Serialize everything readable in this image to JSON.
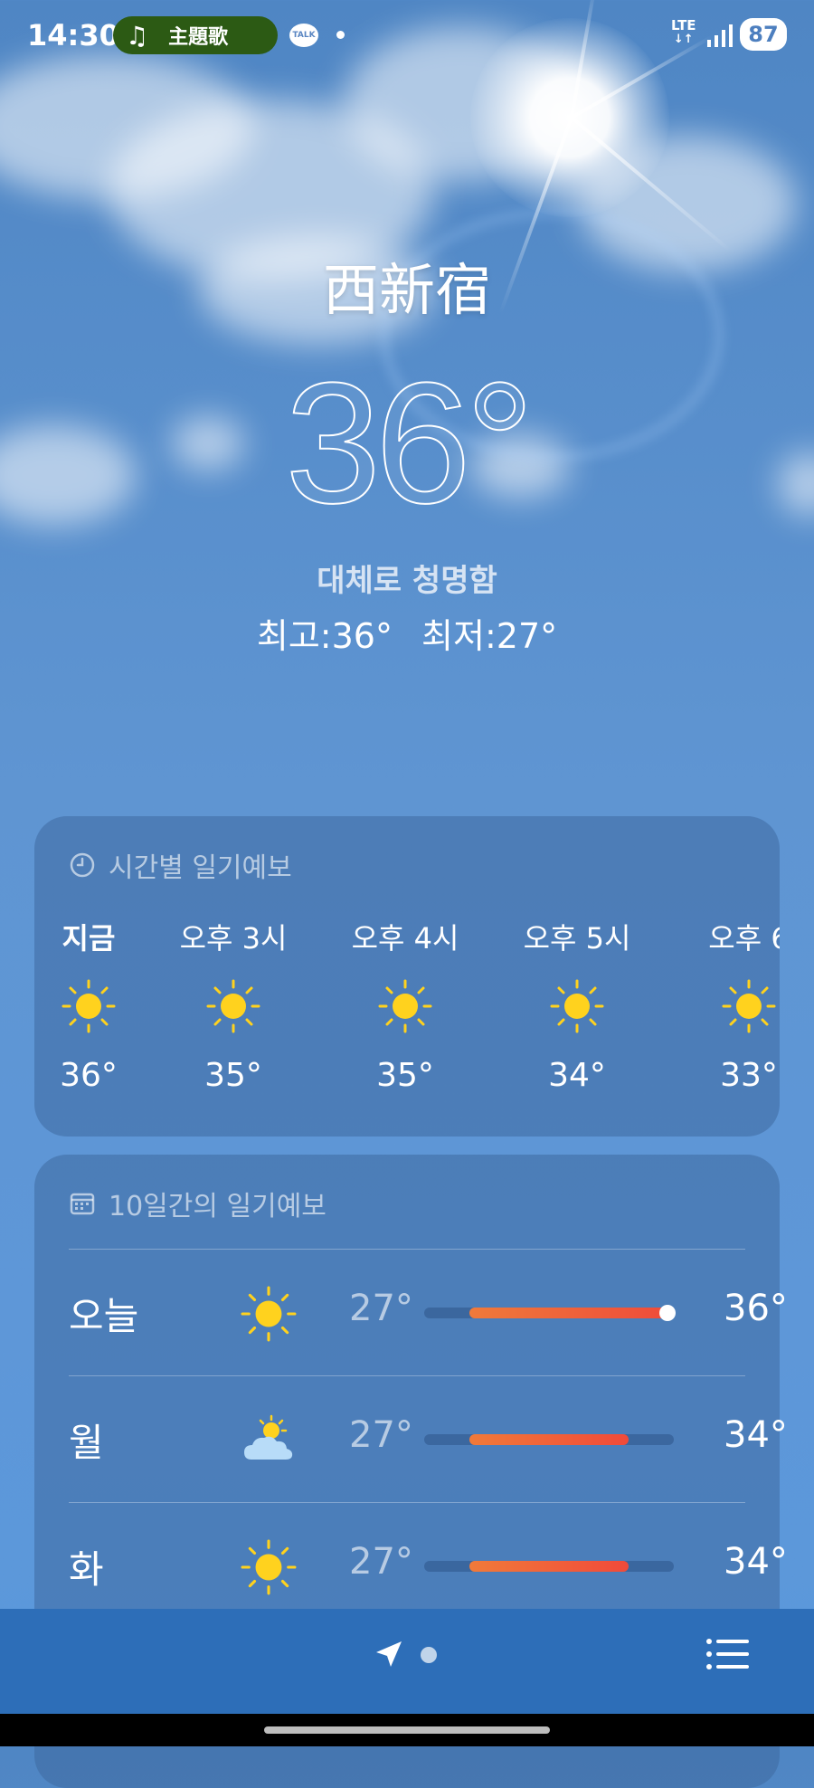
{
  "status_bar": {
    "time": "14:30",
    "music_note": "♫",
    "song_title": "主題歌",
    "talk_label": "TALK",
    "network": "LTE",
    "battery": "87"
  },
  "location": {
    "city": "西新宿",
    "temperature": "36°",
    "condition": "대체로 청명함",
    "high": "최고:36°",
    "low": "최저:27°"
  },
  "hourly": {
    "title": "시간별 일기예보",
    "title_icon": "clock-icon",
    "items": [
      {
        "label": "지금",
        "icon": "sun-icon",
        "temp": "36°"
      },
      {
        "label": "오후 3시",
        "icon": "sun-icon",
        "temp": "35°"
      },
      {
        "label": "오후 4시",
        "icon": "sun-icon",
        "temp": "35°"
      },
      {
        "label": "오후 5시",
        "icon": "sun-icon",
        "temp": "34°"
      },
      {
        "label": "오후 6",
        "icon": "sun-icon",
        "temp": "33°"
      }
    ]
  },
  "daily": {
    "title": "10일간의 일기예보",
    "title_icon": "calendar-icon",
    "range_fraction": [
      {
        "start": 0.18,
        "end": 1.0
      },
      {
        "start": 0.18,
        "end": 0.82
      },
      {
        "start": 0.18,
        "end": 0.82
      }
    ],
    "days": [
      {
        "day": "오늘",
        "icon": "sun-icon",
        "low": "27°",
        "high": "36°",
        "current_marker": true
      },
      {
        "day": "월",
        "icon": "partly-cloudy-icon",
        "low": "27°",
        "high": "34°",
        "current_marker": false
      },
      {
        "day": "화",
        "icon": "sun-icon",
        "low": "27°",
        "high": "34°",
        "current_marker": false
      }
    ]
  },
  "bottom_bar": {
    "left_icon": "location-arrow-icon",
    "page_indicator": "page-dot",
    "right_icon": "list-icon"
  },
  "colors": {
    "sun": "#ffd21e",
    "bar_start": "#f07a3a",
    "bar_end": "#f04a3a",
    "bottom_bar": "#2d6eb8"
  }
}
